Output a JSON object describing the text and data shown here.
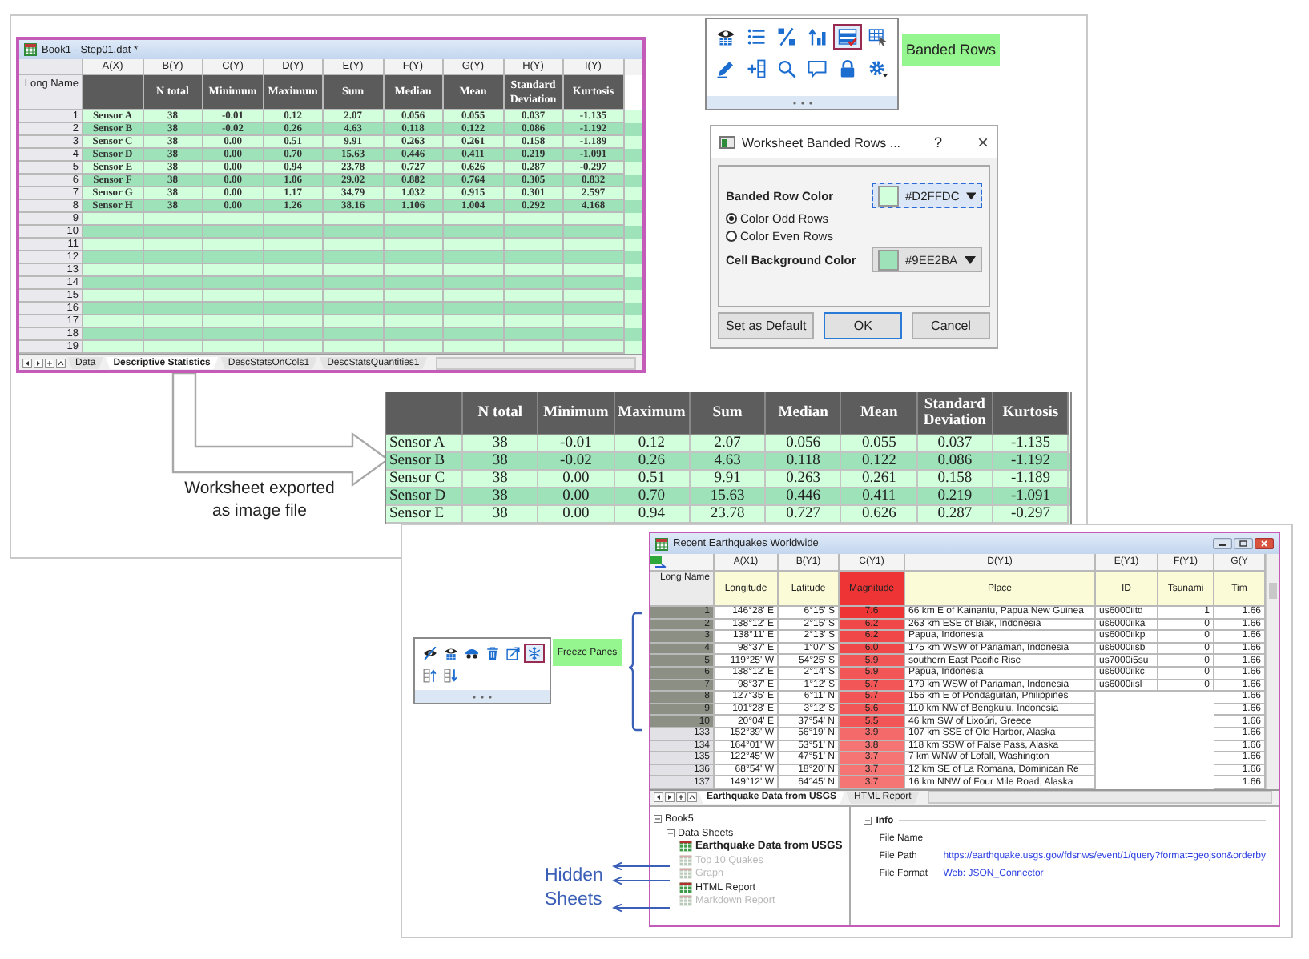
{
  "worksheet": {
    "title": "Book1 - Step01.dat *",
    "columns": [
      "A(X)",
      "B(Y)",
      "C(Y)",
      "D(Y)",
      "E(Y)",
      "F(Y)",
      "G(Y)",
      "H(Y)",
      "I(Y)"
    ],
    "long_name_label": "Long Name",
    "long_names": [
      "N total",
      "Minimum",
      "Maximum",
      "Sum",
      "Median",
      "Mean",
      "Standard Deviation",
      "Kurtosis"
    ],
    "rows": [
      {
        "number": "1",
        "cells": [
          "Sensor A",
          "38",
          "-0.01",
          "0.12",
          "2.07",
          "0.056",
          "0.055",
          "0.037",
          "-1.135"
        ]
      },
      {
        "number": "2",
        "cells": [
          "Sensor B",
          "38",
          "-0.02",
          "0.26",
          "4.63",
          "0.118",
          "0.122",
          "0.086",
          "-1.192"
        ]
      },
      {
        "number": "3",
        "cells": [
          "Sensor C",
          "38",
          "0.00",
          "0.51",
          "9.91",
          "0.263",
          "0.261",
          "0.158",
          "-1.189"
        ]
      },
      {
        "number": "4",
        "cells": [
          "Sensor D",
          "38",
          "0.00",
          "0.70",
          "15.63",
          "0.446",
          "0.411",
          "0.219",
          "-1.091"
        ]
      },
      {
        "number": "5",
        "cells": [
          "Sensor E",
          "38",
          "0.00",
          "0.94",
          "23.78",
          "0.727",
          "0.626",
          "0.287",
          "-0.297"
        ]
      },
      {
        "number": "6",
        "cells": [
          "Sensor F",
          "38",
          "0.00",
          "1.06",
          "29.02",
          "0.882",
          "0.764",
          "0.305",
          "0.832"
        ]
      },
      {
        "number": "7",
        "cells": [
          "Sensor G",
          "38",
          "0.00",
          "1.17",
          "34.79",
          "1.032",
          "0.915",
          "0.301",
          "2.597"
        ]
      },
      {
        "number": "8",
        "cells": [
          "Sensor H",
          "38",
          "0.00",
          "1.26",
          "38.16",
          "1.106",
          "1.004",
          "0.292",
          "4.168"
        ]
      },
      {
        "number": "9"
      },
      {
        "number": "10"
      },
      {
        "number": "11"
      },
      {
        "number": "12"
      },
      {
        "number": "13"
      },
      {
        "number": "14"
      },
      {
        "number": "15"
      },
      {
        "number": "16"
      },
      {
        "number": "17"
      },
      {
        "number": "18"
      },
      {
        "number": "19"
      }
    ],
    "sheet_tabs": [
      {
        "label": "Data",
        "selected": false
      },
      {
        "label": "Descriptive Statistics",
        "selected": true
      },
      {
        "label": "DescStatsOnCols1",
        "selected": false
      },
      {
        "label": "DescStatsQuantities1",
        "selected": false
      }
    ]
  },
  "toolbar_top": {
    "buttons": [
      {
        "kind": "eye-table",
        "selected": false
      },
      {
        "kind": "list",
        "selected": false
      },
      {
        "kind": "slash",
        "selected": false
      },
      {
        "kind": "sort",
        "selected": false
      },
      {
        "kind": "banded-table",
        "selected": true
      },
      {
        "kind": "table-pointer",
        "selected": false
      },
      {
        "kind": "pencil",
        "selected": false
      },
      {
        "kind": "add-column",
        "selected": false
      },
      {
        "kind": "search",
        "selected": false
      },
      {
        "kind": "comment",
        "selected": false
      },
      {
        "kind": "lock",
        "selected": false
      },
      {
        "kind": "settings",
        "selected": false
      }
    ],
    "tooltip": "Banded Rows"
  },
  "banded_dialog": {
    "title": "Worksheet Banded Rows ...",
    "help": "?",
    "close": "×",
    "banded_label": "Banded Row Color",
    "banded_color": "#D2FFDC",
    "options": [
      {
        "label": "Color Odd Rows",
        "selected": true
      },
      {
        "label": "Color Even Rows",
        "selected": false
      }
    ],
    "background_label": "Cell Background Color",
    "background_color": "#9EE2BA",
    "buttons": [
      "Set as Default",
      "OK",
      "Cancel"
    ]
  },
  "export_caption": "Worksheet exported as image file",
  "exported_table": {
    "columns": [
      "",
      "N total",
      "Minimum",
      "Maximum",
      "Sum",
      "Median",
      "Mean",
      "Standard Deviation",
      "Kurtosis"
    ],
    "rows": [
      {
        "cells": [
          "Sensor A",
          "38",
          "-0.01",
          "0.12",
          "2.07",
          "0.056",
          "0.055",
          "0.037",
          "-1.135"
        ]
      },
      {
        "cells": [
          "Sensor B",
          "38",
          "-0.02",
          "0.26",
          "4.63",
          "0.118",
          "0.122",
          "0.086",
          "-1.192"
        ]
      },
      {
        "cells": [
          "Sensor C",
          "38",
          "0.00",
          "0.51",
          "9.91",
          "0.263",
          "0.261",
          "0.158",
          "-1.189"
        ]
      },
      {
        "cells": [
          "Sensor D",
          "38",
          "0.00",
          "0.70",
          "15.63",
          "0.446",
          "0.411",
          "0.219",
          "-1.091"
        ]
      },
      {
        "cells": [
          "Sensor E",
          "38",
          "0.00",
          "0.94",
          "23.78",
          "0.727",
          "0.626",
          "0.287",
          "-0.297"
        ]
      }
    ]
  },
  "toolbar_bottom": {
    "buttons": [
      {
        "kind": "eye-slash",
        "selected": false
      },
      {
        "kind": "eye-table",
        "selected": false
      },
      {
        "kind": "mask",
        "selected": false
      },
      {
        "kind": "trash",
        "selected": false
      },
      {
        "kind": "export",
        "selected": false
      },
      {
        "kind": "snowflake",
        "selected": true
      },
      {
        "kind": "move-up",
        "selected": false
      },
      {
        "kind": "move-down",
        "selected": false
      }
    ],
    "tooltip": "Freeze Panes"
  },
  "quake_window": {
    "title": "Recent Earthquakes Worldwide",
    "columns": [
      "A(X1)",
      "B(Y1)",
      "C(Y1)",
      "D(Y1)",
      "E(Y1)",
      "F(Y1)",
      "G(Y"
    ],
    "long_name_label": "Long Name",
    "long_names": [
      "Longitude",
      "Latitude",
      "Magnitude",
      "Place",
      "ID",
      "Tsunami",
      "Tim"
    ],
    "rows": [
      {
        "number": "1",
        "frozen": true,
        "longitude": "146°28' E",
        "latitude": "6°15' S",
        "magnitude": "7.6",
        "color": "#ee3434",
        "place": "66 km E of Kainantu, Papua New Guinea",
        "id": "us6000iitd",
        "tsunami": "1",
        "time": "1.66"
      },
      {
        "number": "2",
        "frozen": true,
        "longitude": "138°12' E",
        "latitude": "2°15' S",
        "magnitude": "6.2",
        "color": "#f04848",
        "place": "263 km ESE of Biak, Indonesia",
        "id": "us6000iika",
        "tsunami": "0",
        "time": "1.66"
      },
      {
        "number": "3",
        "frozen": true,
        "longitude": "138°11' E",
        "latitude": "2°13' S",
        "magnitude": "6.2",
        "color": "#f04848",
        "place": "Papua, Indonesia",
        "id": "us6000iikp",
        "tsunami": "0",
        "time": "1.66"
      },
      {
        "number": "4",
        "frozen": true,
        "longitude": "98°37' E",
        "latitude": "1°07' S",
        "magnitude": "6.0",
        "color": "#f04848",
        "place": "175 km WSW of Pariaman, Indonesia",
        "id": "us6000iisb",
        "tsunami": "0",
        "time": "1.66"
      },
      {
        "number": "5",
        "frozen": true,
        "longitude": "119°25' W",
        "latitude": "54°25' S",
        "magnitude": "5.9",
        "color": "#f25656",
        "place": "southern East Pacific Rise",
        "id": "us7000i5su",
        "tsunami": "0",
        "time": "1.66"
      },
      {
        "number": "6",
        "frozen": true,
        "longitude": "138°12' E",
        "latitude": "2°14' S",
        "magnitude": "5.9",
        "color": "#f25656",
        "place": "Papua, Indonesia",
        "id": "us6000iikc",
        "tsunami": "0",
        "time": "1.66"
      },
      {
        "number": "7",
        "frozen": true,
        "longitude": "98°37' E",
        "latitude": "1°12' S",
        "magnitude": "5.7",
        "color": "#f25656",
        "place": "179 km WSW of Pariaman, Indonesia",
        "id": "us6000iisl",
        "tsunami": "0",
        "time": "1.66"
      },
      {
        "number": "8",
        "frozen": true,
        "longitude": "127°35' E",
        "latitude": "6°11' N",
        "magnitude": "5.7",
        "color": "#f25656",
        "place": "156 km E of Pondaguitan, Philippines",
        "time": "1.66"
      },
      {
        "number": "9",
        "frozen": true,
        "longitude": "101°28' E",
        "latitude": "3°12' S",
        "magnitude": "5.6",
        "color": "#f25656",
        "place": "110 km NW of Bengkulu, Indonesia",
        "time": "1.66"
      },
      {
        "number": "10",
        "frozen": true,
        "longitude": "20°04' E",
        "latitude": "37°54' N",
        "magnitude": "5.5",
        "color": "#f25656",
        "place": "46 km SW of Lixoúri, Greece",
        "time": "1.66"
      },
      {
        "number": "133",
        "frozen": false,
        "longitude": "152°39' W",
        "latitude": "56°19' N",
        "magnitude": "3.9",
        "color": "#f46a6a",
        "place": "107 km SSE of Old Harbor, Alaska",
        "time": "1.66"
      },
      {
        "number": "134",
        "frozen": false,
        "longitude": "164°01' W",
        "latitude": "53°51' N",
        "magnitude": "3.8",
        "color": "#f57575",
        "place": "118 km SSW of False Pass, Alaska",
        "time": "1.66"
      },
      {
        "number": "135",
        "frozen": false,
        "longitude": "122°45' W",
        "latitude": "47°51' N",
        "magnitude": "3.7",
        "color": "#f57575",
        "place": "7 km WNW of Lofall, Washington",
        "time": "1.66"
      },
      {
        "number": "136",
        "frozen": false,
        "longitude": "68°54' W",
        "latitude": "18°20' N",
        "magnitude": "3.7",
        "color": "#f57575",
        "place": "12 km SE of La Romana, Dominican Re",
        "time": "1.66"
      },
      {
        "number": "137",
        "frozen": false,
        "longitude": "149°12' W",
        "latitude": "64°45' N",
        "magnitude": "3.7",
        "color": "#f57575",
        "place": "16 km NNW of Four Mile Road, Alaska",
        "time": "1.66"
      }
    ],
    "sheet_tabs": [
      {
        "label": "Earthquake Data from USGS",
        "selected": true
      },
      {
        "label": "HTML Report",
        "selected": false
      }
    ],
    "tree": {
      "label": "Book5",
      "expanded": true,
      "children": [
        {
          "label": "Data Sheets",
          "expanded": true,
          "children": [
            {
              "label": "Earthquake Data from USGS",
              "active": true,
              "hidden": false
            },
            {
              "label": "Top 10 Quakes",
              "active": false,
              "hidden": true
            },
            {
              "label": "Graph",
              "active": false,
              "hidden": true
            },
            {
              "label": "HTML Report",
              "active": false,
              "hidden": false
            },
            {
              "label": "Markdown Report",
              "active": false,
              "hidden": true
            }
          ]
        }
      ]
    },
    "info": {
      "title": "Info",
      "expanded": true,
      "fields": [
        {
          "label": "File Name"
        },
        {
          "label": "File Path",
          "value": "https://earthquake.usgs.gov/fdsnws/event/1/query?format=geojson&orderby"
        },
        {
          "label": "File Format",
          "value": "Web: JSON_Connector"
        }
      ]
    }
  },
  "hidden_caption": "Hidden Sheets"
}
